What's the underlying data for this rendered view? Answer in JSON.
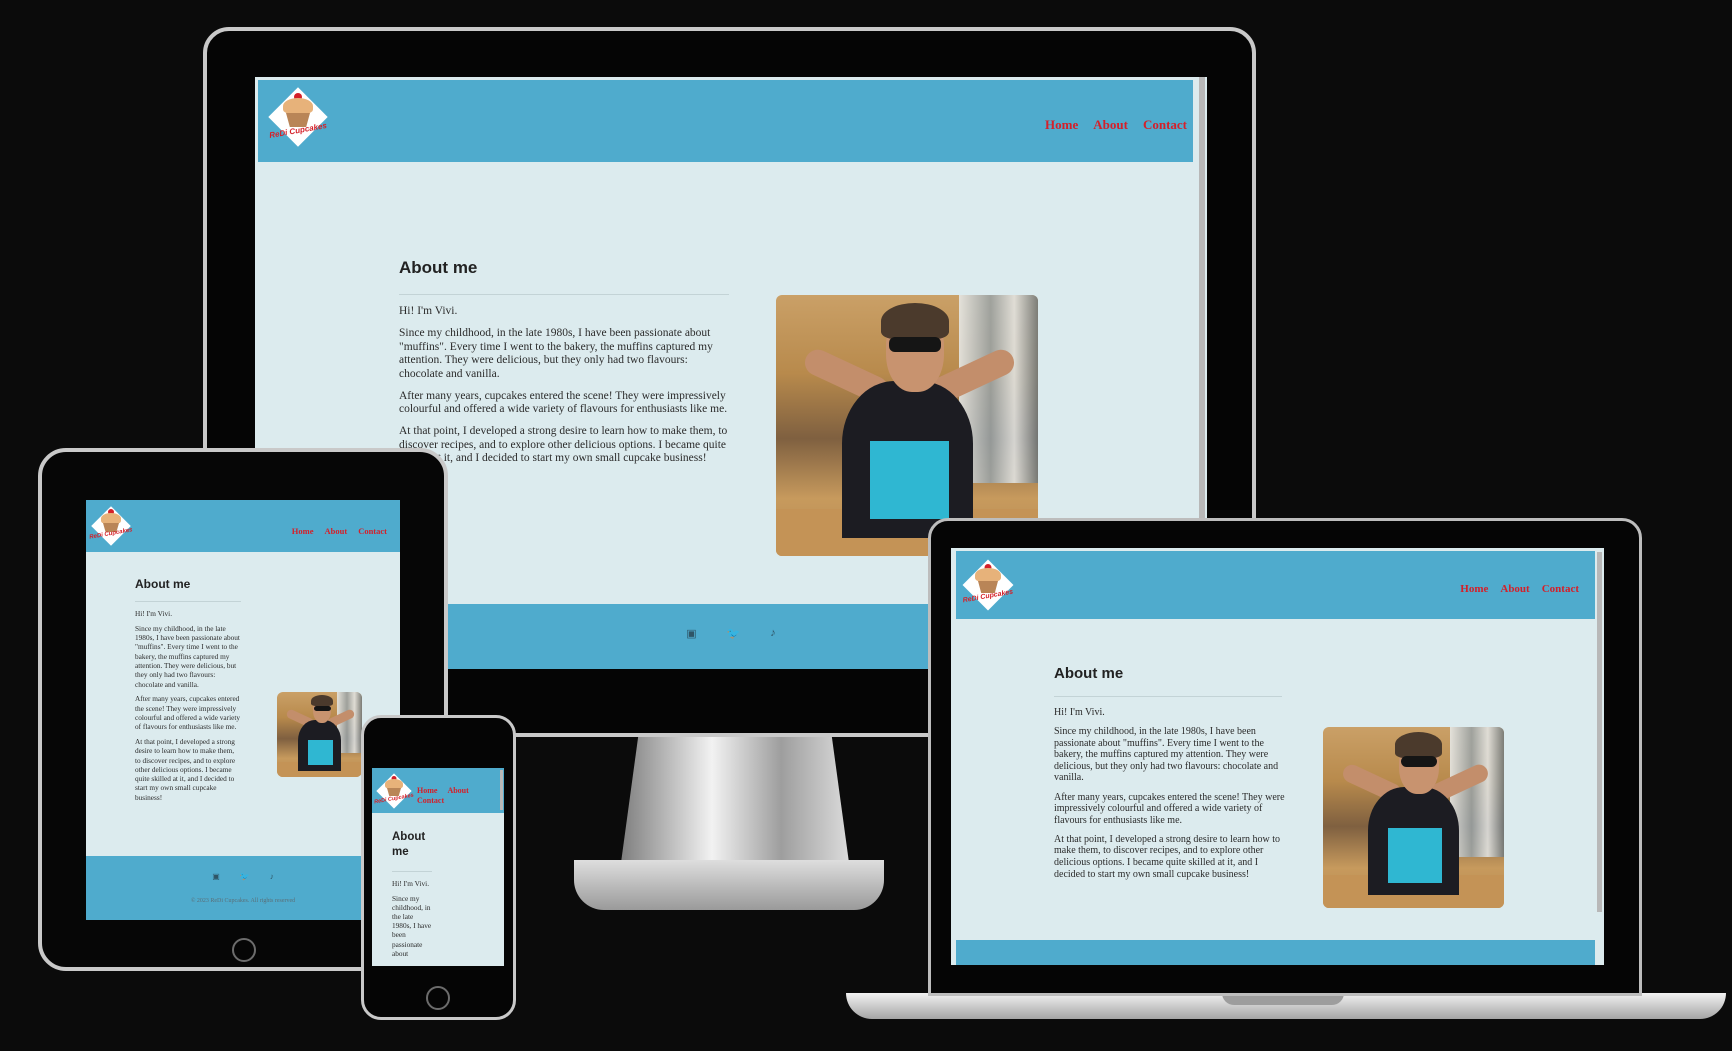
{
  "site": {
    "logo_text": "ReDi Cupcakes",
    "nav": [
      "Home",
      "About",
      "Contact"
    ],
    "heading": "About me",
    "phone_heading": [
      "About",
      "me"
    ],
    "paragraphs": [
      "Hi! I'm Vivi.",
      "Since my childhood, in the late 1980s, I have been passionate about \"muffins\". Every time I went to the bakery, the muffins captured my attention. They were delicious, but they only had two flavours: chocolate and vanilla.",
      "After many years, cupcakes entered the scene! They were impressively colourful and offered a wide variety of flavours for enthusiasts like me.",
      "At that point, I developed a strong desire to learn how to make them, to discover recipes, and to explore other delicious options. I became quite skilled at it, and I decided to start my own small cupcake business!"
    ],
    "monitor_partial_p3": "oint, I developed a strong desire to learn how to make\ndiscover recipes, and to explore other delicious options. I\nquite skilled at it, and I decided to start my own small\nbusiness!",
    "phone_partial": "Since my childhood, in the late 1980s, I have been passionate about",
    "footer_icons": [
      "instagram-icon",
      "twitter-icon",
      "tiktok-icon"
    ],
    "icon_glyphs": {
      "instagram": "▣",
      "twitter": "🐦",
      "tiktok": "♪"
    },
    "copyright": "© 2023 ReDi Cupcakes. All rights reserved"
  },
  "colors": {
    "header": "#4fabcd",
    "page_bg": "#dcebee",
    "nav_link": "#d4202a",
    "backdrop": "#0b0b0b"
  }
}
